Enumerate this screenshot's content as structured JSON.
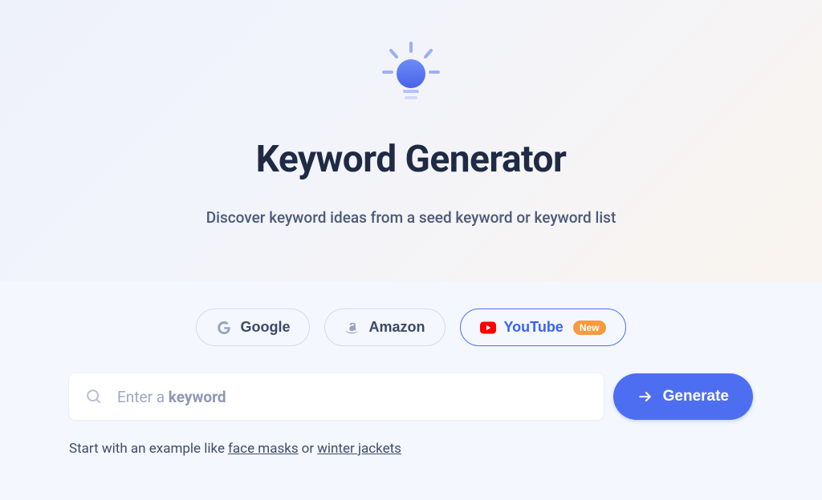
{
  "hero": {
    "title": "Keyword Generator",
    "subtitle": "Discover keyword ideas from a seed keyword or keyword list"
  },
  "tabs": {
    "google": {
      "label": "Google"
    },
    "amazon": {
      "label": "Amazon"
    },
    "youtube": {
      "label": "YouTube",
      "badge": "New"
    }
  },
  "search": {
    "placeholder_prefix": "Enter a ",
    "placeholder_bold": "keyword",
    "value": ""
  },
  "generate": {
    "label": "Generate"
  },
  "example": {
    "prefix": "Start with an example like ",
    "link1": "face masks",
    "joiner": " or ",
    "link2": "winter jackets"
  }
}
